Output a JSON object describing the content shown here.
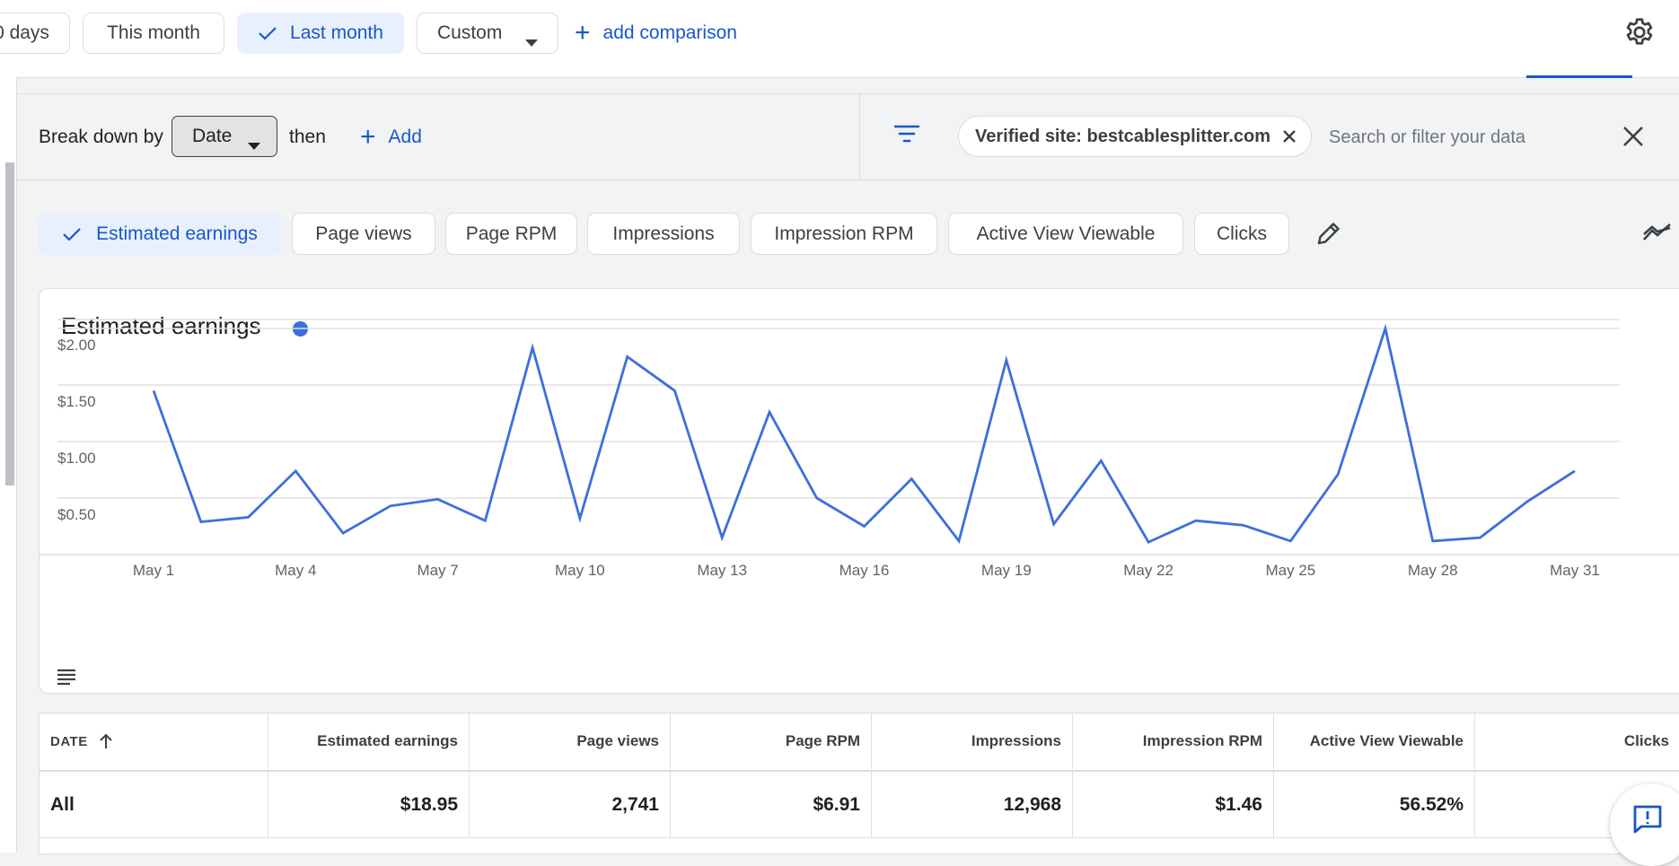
{
  "date_range": {
    "chips": [
      {
        "label": "0 days",
        "selected": false
      },
      {
        "label": "This month",
        "selected": false
      },
      {
        "label": "Last month",
        "selected": true
      }
    ],
    "custom_label": "Custom",
    "add_comparison_label": "add comparison"
  },
  "breakdown": {
    "label": "Break down by",
    "dimension": "Date",
    "then_label": "then",
    "add_label": "Add"
  },
  "filter": {
    "chip_label": "Verified site: bestcablesplitter.com",
    "search_placeholder": "Search or filter your data"
  },
  "metrics": [
    {
      "label": "Estimated earnings",
      "selected": true
    },
    {
      "label": "Page views",
      "selected": false
    },
    {
      "label": "Page RPM",
      "selected": false
    },
    {
      "label": "Impressions",
      "selected": false
    },
    {
      "label": "Impression RPM",
      "selected": false
    },
    {
      "label": "Active View Viewable",
      "selected": false
    },
    {
      "label": "Clicks",
      "selected": false
    }
  ],
  "chart_data": {
    "type": "line",
    "title": "Estimated earnings",
    "series": [
      {
        "values": [
          1.45,
          0.29,
          0.33,
          0.74,
          0.19,
          0.43,
          0.49,
          0.3,
          1.83,
          0.32,
          1.75,
          1.45,
          0.15,
          1.26,
          0.5,
          0.25,
          0.67,
          0.12,
          1.72,
          0.27,
          0.83,
          0.11,
          0.3,
          0.26,
          0.12,
          0.71,
          2.0,
          0.12,
          0.15,
          0.47,
          0.74
        ],
        "color": "#3c6fdc"
      }
    ],
    "x": [
      "May 1",
      "May 2",
      "May 3",
      "May 4",
      "May 5",
      "May 6",
      "May 7",
      "May 8",
      "May 9",
      "May 10",
      "May 11",
      "May 12",
      "May 13",
      "May 14",
      "May 15",
      "May 16",
      "May 17",
      "May 18",
      "May 19",
      "May 20",
      "May 21",
      "May 22",
      "May 23",
      "May 24",
      "May 25",
      "May 26",
      "May 27",
      "May 28",
      "May 29",
      "May 30",
      "May 31"
    ],
    "x_tick_labels": [
      "May 1",
      "May 4",
      "May 7",
      "May 10",
      "May 13",
      "May 16",
      "May 19",
      "May 22",
      "May 25",
      "May 28",
      "May 31"
    ],
    "y_tick_labels": [
      "$2.00",
      "$1.50",
      "$1.00",
      "$0.50"
    ],
    "y_ticks": [
      2.0,
      1.5,
      1.0,
      0.5
    ],
    "ylim": [
      0,
      2.0
    ],
    "grid": true
  },
  "table": {
    "columns": [
      "DATE",
      "Estimated earnings",
      "Page views",
      "Page RPM",
      "Impressions",
      "Impression RPM",
      "Active View Viewable",
      "Clicks"
    ],
    "total_row": [
      "All",
      "$18.95",
      "2,741",
      "$6.91",
      "12,968",
      "$1.46",
      "56.52%",
      ""
    ]
  }
}
